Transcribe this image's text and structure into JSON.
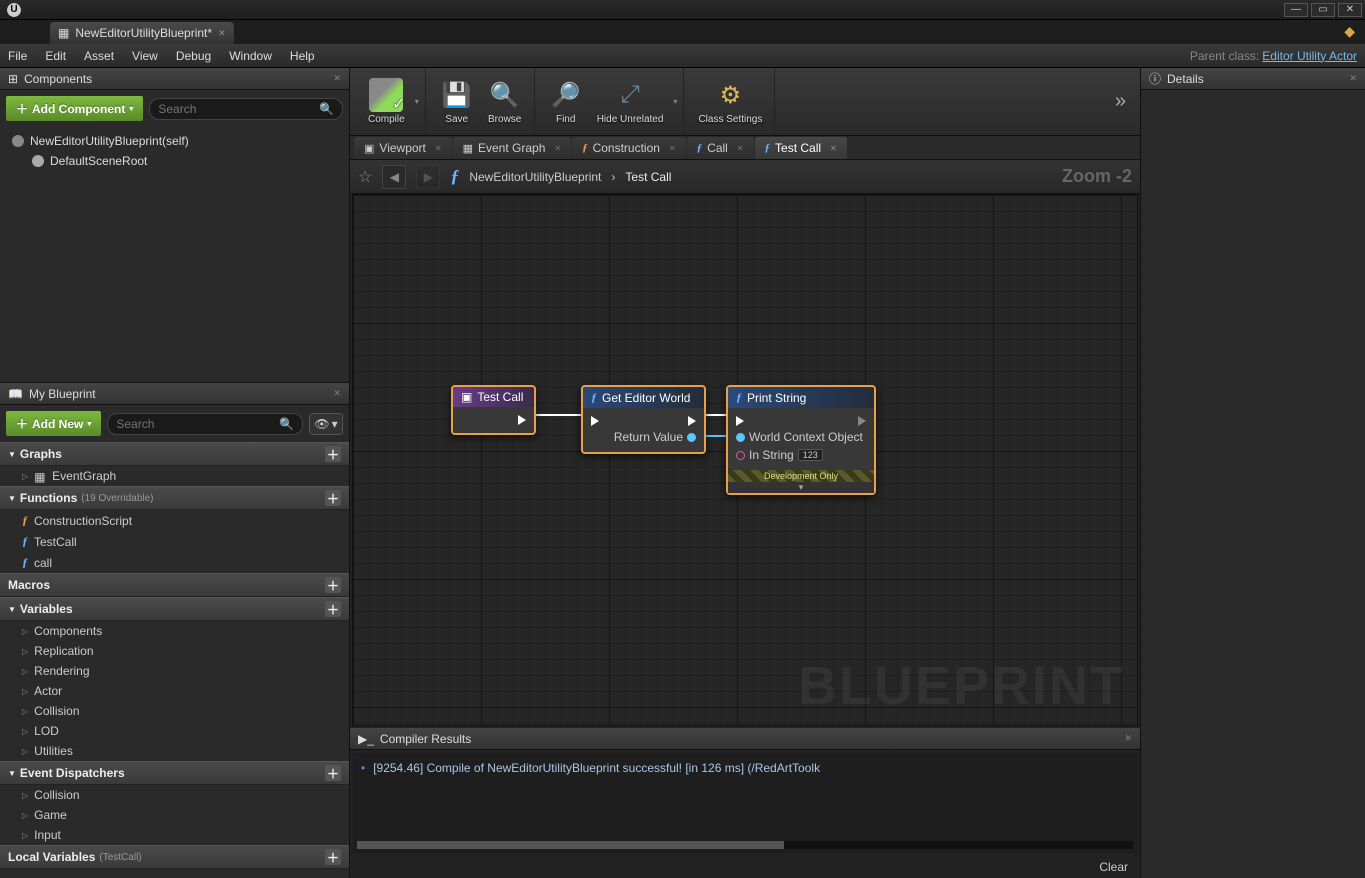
{
  "window": {
    "doctab": "NewEditorUtilityBlueprint*",
    "min": "—",
    "max": "▭",
    "close": "✕"
  },
  "menu": {
    "items": [
      "File",
      "Edit",
      "Asset",
      "View",
      "Debug",
      "Window",
      "Help"
    ],
    "parent_label": "Parent class:",
    "parent_class": "Editor Utility Actor"
  },
  "toolbar": {
    "compile": "Compile",
    "save": "Save",
    "browse": "Browse",
    "find": "Find",
    "hide": "Hide Unrelated",
    "settings": "Class Settings"
  },
  "components": {
    "title": "Components",
    "add": "Add Component",
    "search_ph": "Search",
    "root": "NewEditorUtilityBlueprint(self)",
    "child": "DefaultSceneRoot"
  },
  "myblueprint": {
    "title": "My Blueprint",
    "add": "Add New",
    "search_ph": "Search",
    "cats": {
      "graphs": "Graphs",
      "event_graph": "EventGraph",
      "functions": "Functions",
      "functions_sub": "(19 Overridable)",
      "fn1": "ConstructionScript",
      "fn2": "TestCall",
      "fn3": "call",
      "macros": "Macros",
      "variables": "Variables",
      "vars": [
        "Components",
        "Replication",
        "Rendering",
        "Actor",
        "Collision",
        "LOD",
        "Utilities"
      ],
      "disp": "Event Dispatchers",
      "disps": [
        "Collision",
        "Game",
        "Input"
      ],
      "local": "Local Variables",
      "local_sub": "(TestCall)"
    }
  },
  "graph_tabs": {
    "viewport": "Viewport",
    "event": "Event Graph",
    "constr": "Construction",
    "call": "Call",
    "test": "Test Call"
  },
  "breadcrumb": {
    "class": "NewEditorUtilityBlueprint",
    "func": "Test Call",
    "zoom": "Zoom -2"
  },
  "nodes": {
    "testcall": "Test Call",
    "geteditor": "Get Editor World",
    "return": "Return Value",
    "print": "Print String",
    "wco": "World Context Object",
    "instring": "In String",
    "instr_val": "123",
    "devonly": "Development Only"
  },
  "compiler": {
    "title": "Compiler Results",
    "log": "[9254.46] Compile of NewEditorUtilityBlueprint successful! [in 126 ms] (/RedArtToolk",
    "clear": "Clear"
  },
  "details": {
    "title": "Details"
  },
  "watermark": "BLUEPRINT"
}
